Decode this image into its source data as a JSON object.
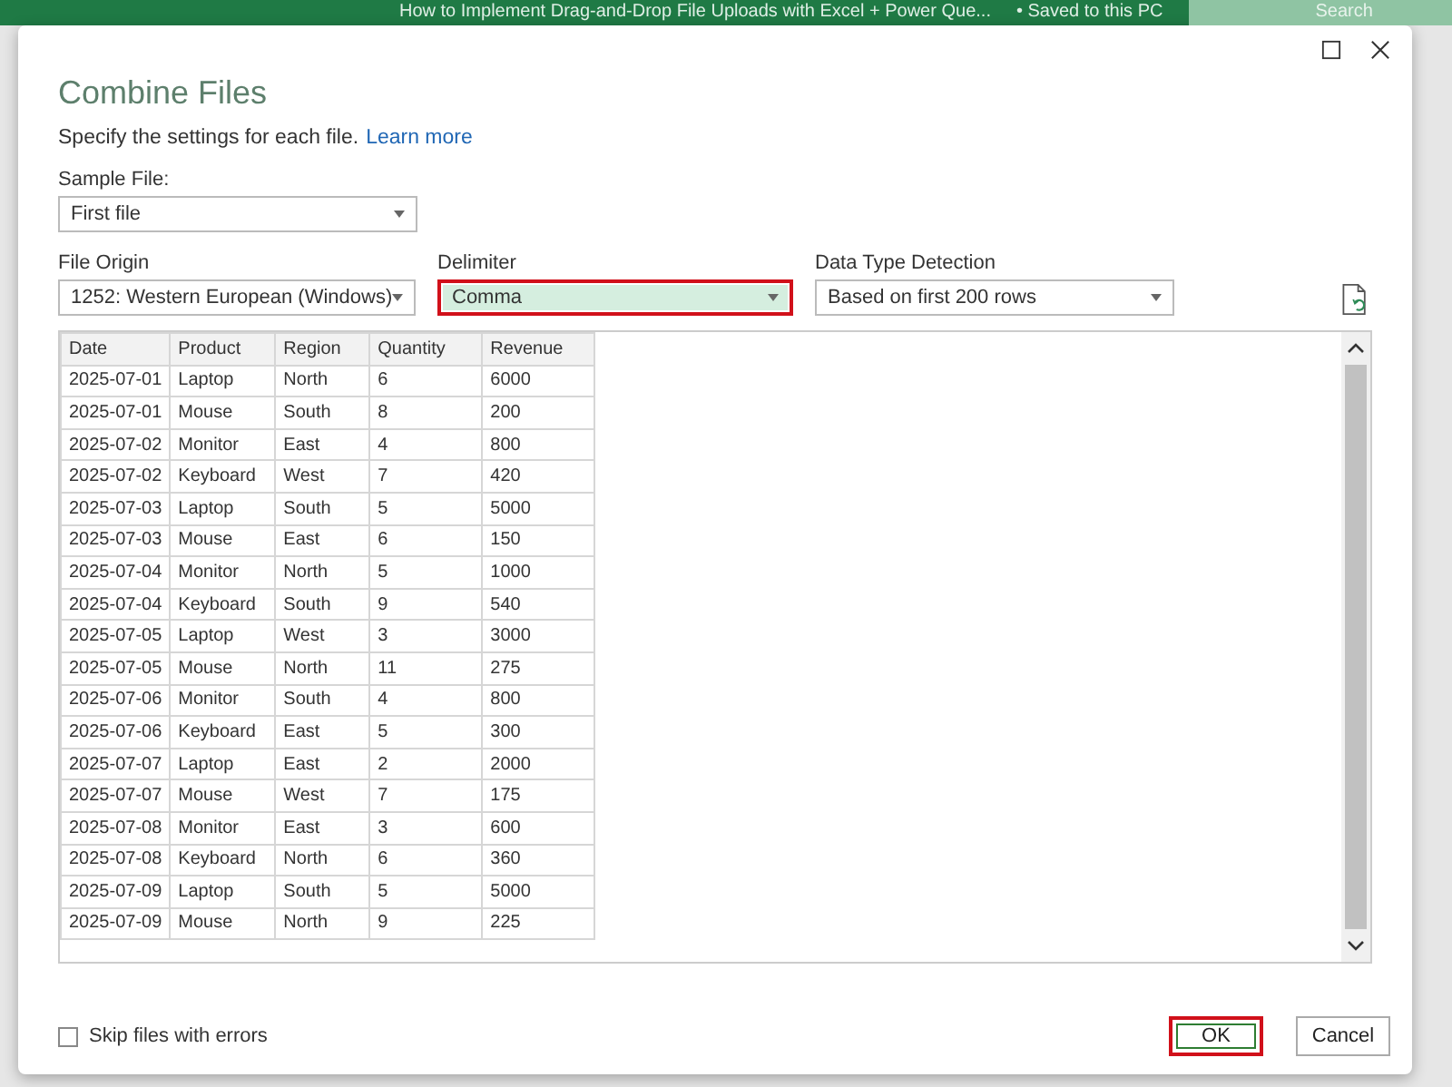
{
  "background_window": {
    "title": "How to Implement Drag-and-Drop File Uploads with Excel + Power Que...",
    "save_status": "• Saved to this PC",
    "search_placeholder": "Search"
  },
  "dialog": {
    "title": "Combine Files",
    "subtitle": "Specify the settings for each file.",
    "link": "Learn more",
    "sample_file": {
      "label": "Sample File:",
      "value": "First file",
      "highlighted": false,
      "annotated": false
    },
    "settings": [
      {
        "label": "File Origin",
        "value": "1252: Western European (Windows)",
        "highlighted": false,
        "annotated": false
      },
      {
        "label": "Delimiter",
        "value": "Comma",
        "highlighted": true,
        "annotated": true
      },
      {
        "label": "Data Type Detection",
        "value": "Based on first 200 rows",
        "highlighted": false,
        "annotated": false
      }
    ],
    "table": {
      "columns": [
        "Date",
        "Product",
        "Region",
        "Quantity",
        "Revenue"
      ],
      "rows": [
        [
          "2025-07-01",
          "Laptop",
          "North",
          "6",
          "6000"
        ],
        [
          "2025-07-01",
          "Mouse",
          "South",
          "8",
          "200"
        ],
        [
          "2025-07-02",
          "Monitor",
          "East",
          "4",
          "800"
        ],
        [
          "2025-07-02",
          "Keyboard",
          "West",
          "7",
          "420"
        ],
        [
          "2025-07-03",
          "Laptop",
          "South",
          "5",
          "5000"
        ],
        [
          "2025-07-03",
          "Mouse",
          "East",
          "6",
          "150"
        ],
        [
          "2025-07-04",
          "Monitor",
          "North",
          "5",
          "1000"
        ],
        [
          "2025-07-04",
          "Keyboard",
          "South",
          "9",
          "540"
        ],
        [
          "2025-07-05",
          "Laptop",
          "West",
          "3",
          "3000"
        ],
        [
          "2025-07-05",
          "Mouse",
          "North",
          "11",
          "275"
        ],
        [
          "2025-07-06",
          "Monitor",
          "South",
          "4",
          "800"
        ],
        [
          "2025-07-06",
          "Keyboard",
          "East",
          "5",
          "300"
        ],
        [
          "2025-07-07",
          "Laptop",
          "East",
          "2",
          "2000"
        ],
        [
          "2025-07-07",
          "Mouse",
          "West",
          "7",
          "175"
        ],
        [
          "2025-07-08",
          "Monitor",
          "East",
          "3",
          "600"
        ],
        [
          "2025-07-08",
          "Keyboard",
          "North",
          "6",
          "360"
        ],
        [
          "2025-07-09",
          "Laptop",
          "South",
          "5",
          "5000"
        ],
        [
          "2025-07-09",
          "Mouse",
          "North",
          "9",
          "225"
        ]
      ]
    },
    "skip_errors": {
      "label": "Skip files with errors",
      "checked": false
    },
    "buttons": [
      {
        "label": "OK",
        "primary": true,
        "annotated": true
      },
      {
        "label": "Cancel",
        "primary": false,
        "annotated": false
      }
    ]
  }
}
